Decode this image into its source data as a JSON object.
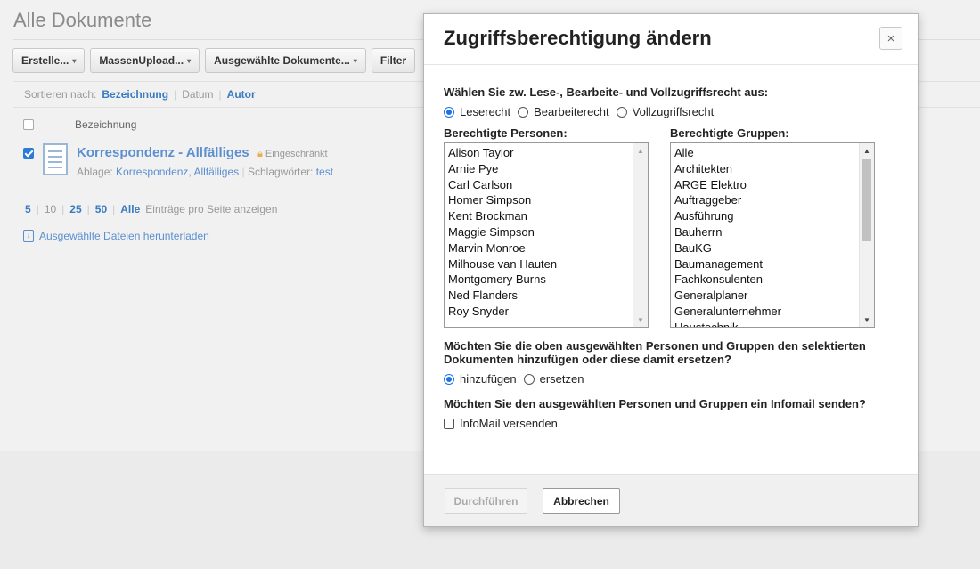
{
  "page": {
    "title": "Alle Dokumente",
    "toolbar": [
      {
        "label": "Erstelle...",
        "caret": "▾"
      },
      {
        "label": "MassenUpload...",
        "caret": "▾"
      },
      {
        "label": "Ausgewählte Dokumente...",
        "caret": "▾"
      },
      {
        "label": "Filter",
        "caret": ""
      }
    ],
    "sort": {
      "label": "Sortieren nach:",
      "bezeichnung": "Bezeichnung",
      "sep1": "|",
      "datum": "Datum",
      "sep2": "|",
      "autor": "Autor"
    },
    "list_header": "Bezeichnung",
    "document": {
      "title": "Korrespondenz - Allfälliges",
      "badge": "Eingeschränkt",
      "ablage_label": "Ablage:",
      "ablage_1": "Korrespondenz,",
      "ablage_2": "Allfälliges",
      "sep": "|",
      "tags_label": "Schlagwörter:",
      "tag": "test"
    },
    "pager": {
      "p5": "5",
      "p10": "10",
      "p25": "25",
      "p50": "50",
      "all": "Alle",
      "sep": "|",
      "text": "Einträge pro Seite anzeigen"
    },
    "download_label": "Ausgewählte Dateien herunterladen"
  },
  "modal": {
    "title": "Zugriffsberechtigung ändern",
    "close_symbol": "×",
    "question_rights": "Wählen Sie zw. Lese-, Bearbeite- und Vollzugriffsrecht aus:",
    "rights": [
      "Leserecht",
      "Bearbeiterecht",
      "Vollzugriffsrecht"
    ],
    "persons_heading": "Berechtigte Personen:",
    "persons": [
      "Alison Taylor",
      "Arnie Pye",
      "Carl Carlson",
      "Homer Simpson",
      "Kent Brockman",
      "Maggie Simpson",
      "Marvin Monroe",
      "Milhouse van Hauten",
      "Montgomery Burns",
      "Ned Flanders",
      "Roy Snyder"
    ],
    "groups_heading": "Berechtigte Gruppen:",
    "groups": [
      "Alle",
      "Architekten",
      "ARGE Elektro",
      "Auftraggeber",
      "Ausführung",
      "Bauherrn",
      "BauKG",
      "Baumanagement",
      "Fachkonsulenten",
      "Generalplaner",
      "Generalunternehmer",
      "Haustechnik"
    ],
    "question_mode": "Möchten Sie die oben ausgewählten Personen und Gruppen den selektierten Dokumenten hinzufügen oder diese damit ersetzen?",
    "modes": [
      "hinzufügen",
      "ersetzen"
    ],
    "question_mail": "Möchten Sie den ausgewählten Personen und Gruppen ein Infomail senden?",
    "mail_checkbox": "InfoMail versenden",
    "submit_label": "Durchführen",
    "cancel_label": "Abbrechen",
    "selected_right": "Leserecht",
    "selected_mode": "hinzufügen"
  },
  "colors": {
    "accent": "#3a7bbf",
    "radio": "#1a73e8",
    "lock": "#e8b04a"
  }
}
